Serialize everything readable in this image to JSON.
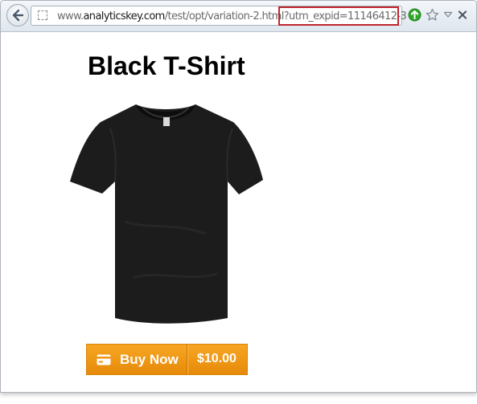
{
  "browser": {
    "url_prefix": "www.",
    "url_host": "analyticskey.com",
    "url_path": "/test/opt/variation-2.html",
    "url_query": "?utm_expid=11146412-3"
  },
  "page": {
    "title": "Black T-Shirt",
    "buy_label": "Buy Now",
    "price": "$10.00"
  },
  "colors": {
    "button_orange": "#ef9513",
    "highlight_red": "#c0262d",
    "shirt": "#1c1c1c"
  },
  "icons": [
    "back-arrow-icon",
    "page-icon",
    "go-icon",
    "star-icon",
    "dropdown-icon",
    "close-icon",
    "credit-card-icon"
  ]
}
